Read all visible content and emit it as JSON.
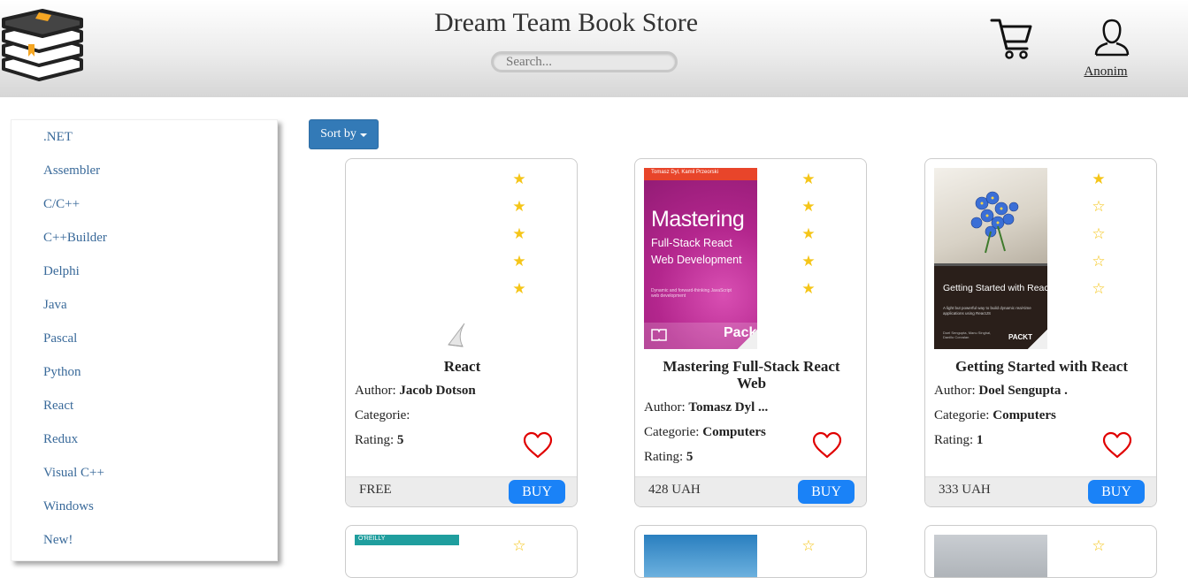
{
  "header": {
    "title": "Dream Team Book Store",
    "search_placeholder": "Search...",
    "user_name": "Anonim"
  },
  "sidebar": {
    "items": [
      ".NET",
      "Assembler",
      "C/C++",
      "C++Builder",
      "Delphi",
      "Java",
      "Pascal",
      "Python",
      "React",
      "Redux",
      "Visual C++",
      "Windows",
      "New!"
    ]
  },
  "sort": {
    "label": "Sort by"
  },
  "books": [
    {
      "title": "React",
      "author_label": "Author:",
      "author": "Jacob Dotson",
      "category_label": "Categorie:",
      "category": "",
      "rating_label": "Rating:",
      "rating": "5",
      "price": "FREE",
      "buy_label": "BUY"
    },
    {
      "title": "Mastering Full-Stack React Web",
      "author_label": "Author:",
      "author": "Tomasz Dyl ...",
      "category_label": "Categorie:",
      "category": "Computers",
      "rating_label": "Rating:",
      "rating": "5",
      "price": "428 UAH",
      "buy_label": "BUY",
      "cover": {
        "authors": "Tomasz Dyl, Kamil Przeorski",
        "line1": "Mastering",
        "line2": "Full-Stack React",
        "line3": "Web Development",
        "blurb": "Dynamic and forward-thinking JavaScript web development",
        "publisher": "Pack"
      }
    },
    {
      "title": "Getting Started with React",
      "author_label": "Author:",
      "author": "Doel Sengupta .",
      "category_label": "Categorie:",
      "category": "Computers",
      "rating_label": "Rating:",
      "rating": "1",
      "price": "333 UAH",
      "buy_label": "BUY",
      "cover": {
        "title": "Getting Started with React",
        "blurb": "A light but powerful way to build dynamic real-time applications using ReactJS",
        "authors": "Doel Sengupta, Manu Singhal, Danillo Corvalan",
        "publisher": "PACKT"
      }
    }
  ],
  "partial_cover_label": "O'REILLY",
  "colors": {
    "accent": "#337ab7",
    "buy": "#1a82f7",
    "star": "#f5c518",
    "heart": "#e00000",
    "link": "#3a6a9a"
  }
}
